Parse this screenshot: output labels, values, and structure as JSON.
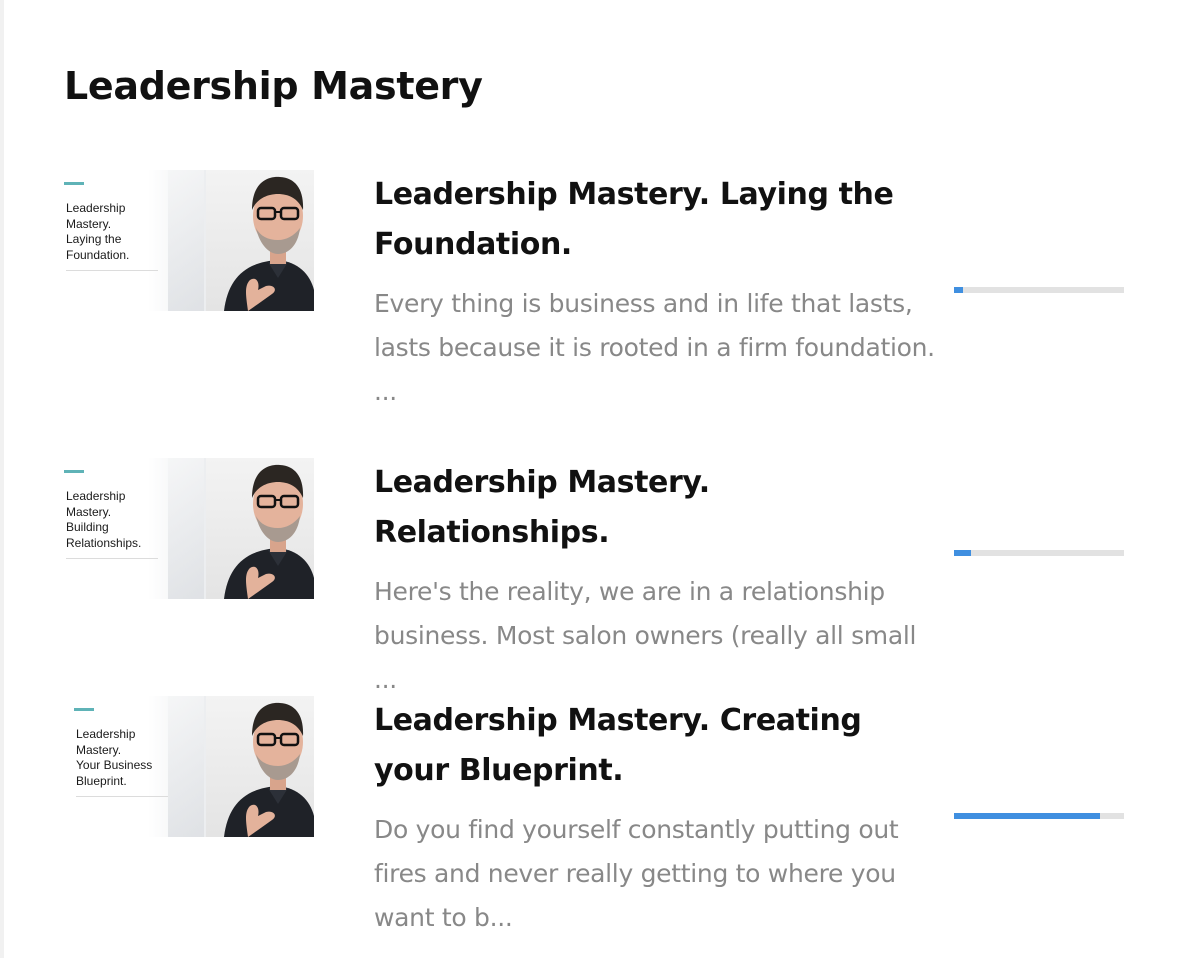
{
  "page": {
    "title": "Leadership Mastery"
  },
  "courses": [
    {
      "thumbnail_caption": "Leadership\nMastery.\nLaying the\nFoundation.",
      "title": "Leadership Mastery. Laying the Foundation.",
      "description": "Every thing is business and in life that lasts, lasts because it is rooted in a firm foundation. ...",
      "progress": 0.05
    },
    {
      "thumbnail_caption": "Leadership\nMastery.\nBuilding\nRelationships.",
      "title": "Leadership Mastery. Relationships.",
      "description": "Here's the reality, we are in a relationship business.  Most salon owners (really all small ...",
      "progress": 0.1
    },
    {
      "thumbnail_caption": "Leadership\nMastery.\nYour Business\nBlueprint.",
      "title": "Leadership Mastery. Creating your Blueprint.",
      "description": "Do you find yourself constantly putting out fires and never really getting to where you want to b...",
      "progress": 0.86
    }
  ],
  "colors": {
    "progress_fill": "#3f8fe0",
    "progress_track": "#e2e2e2",
    "thumbnail_accent": "#5fb3b7",
    "title_text": "#111111",
    "description_text": "#888888"
  },
  "icons": {
    "thumbnail_photo": "presenter-photo"
  }
}
